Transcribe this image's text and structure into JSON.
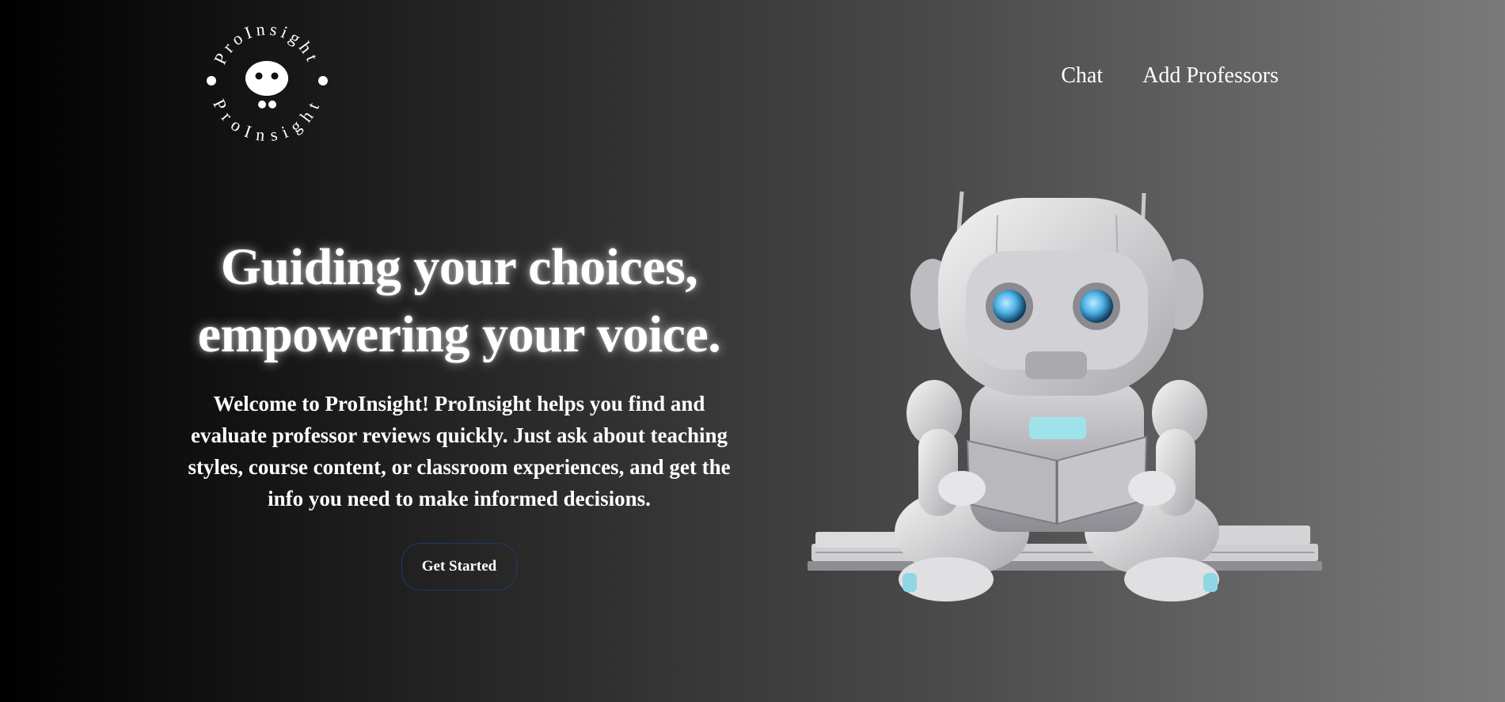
{
  "brand": {
    "logo_text": "ProInsight",
    "logo_icon": "robot-head-icon"
  },
  "nav": {
    "items": [
      {
        "label": "Chat"
      },
      {
        "label": "Add Professors"
      }
    ]
  },
  "hero": {
    "headline_line1": "Guiding your choices,",
    "headline_line2": "empowering your voice.",
    "description": "Welcome to ProInsight! ProInsight helps you find and evaluate professor reviews quickly. Just ask about teaching styles, course content, or classroom experiences, and get the info you need to make informed decisions.",
    "cta_label": "Get Started",
    "illustration": "robot-reading-book-illustration"
  },
  "colors": {
    "background_start": "#000000",
    "background_end": "#7a7a7a",
    "text": "#ffffff",
    "cta_border": "#1f3a66",
    "robot_eye": "#4fb3e8"
  }
}
